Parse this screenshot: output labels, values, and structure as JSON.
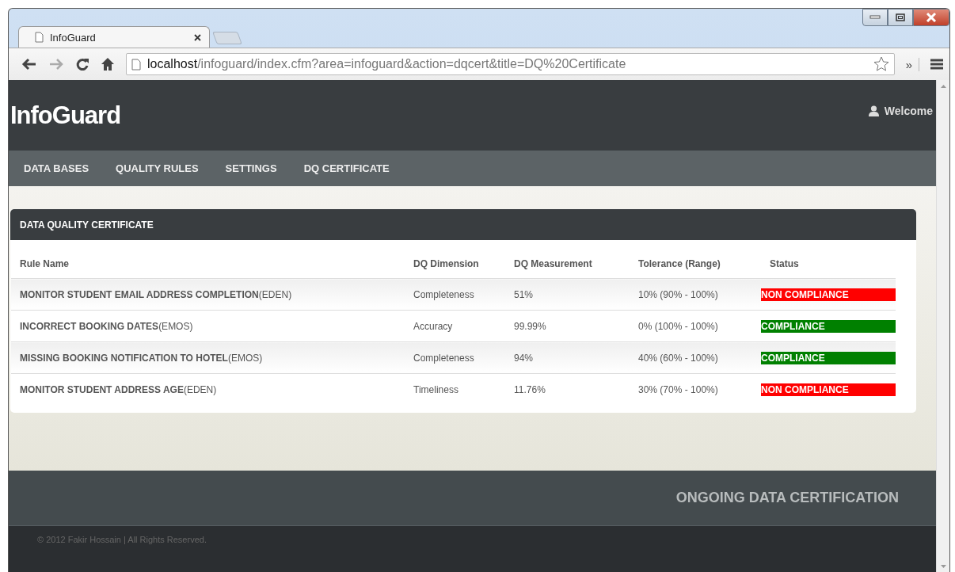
{
  "browser": {
    "tab": {
      "title": "InfoGuard",
      "selected": true
    },
    "address": {
      "host": "localhost",
      "path": "/infoguard/index.cfm?area=infoguard&action=dqcert&title=DQ%20Certificate"
    },
    "overflow": "»"
  },
  "header": {
    "brand": "InfoGuard",
    "user": "Welcome"
  },
  "nav": [
    {
      "label": "DATA BASES"
    },
    {
      "label": "QUALITY RULES"
    },
    {
      "label": "SETTINGS"
    },
    {
      "label": "DQ CERTIFICATE"
    }
  ],
  "panel": {
    "title": "DATA QUALITY CERTIFICATE",
    "table": {
      "columns": [
        "Rule Name",
        "DQ Dimension",
        "DQ Measurement",
        "Tolerance (Range)",
        "Status"
      ],
      "rows": [
        {
          "rule": "**MONITOR STUDENT EMAIL ADDRESS COMPLETION**(EDEN)",
          "dimension": "Completeness",
          "measurement": "51%",
          "tolerance": "10% (90% - 100%)",
          "status": {
            "label": "NON COMPLIANCE",
            "color": "#ff0000"
          }
        },
        {
          "rule": "**INCORRECT BOOKING DATES**(EMOS)",
          "dimension": "Accuracy",
          "measurement": "99.99%",
          "tolerance": "0% (100% - 100%)",
          "status": {
            "label": "COMPLIANCE",
            "color": "#008000"
          }
        },
        {
          "rule": "**MISSING BOOKING NOTIFICATION TO HOTEL**(EMOS)",
          "dimension": "Completeness",
          "measurement": "94%",
          "tolerance": "40% (60% - 100%)",
          "status": {
            "label": "COMPLIANCE",
            "color": "#008000"
          }
        },
        {
          "rule": "**MONITOR STUDENT ADDRESS AGE**(EDEN)",
          "dimension": "Timeliness",
          "measurement": "11.76%",
          "tolerance": "30% (70% - 100%)",
          "status": {
            "label": "NON COMPLIANCE",
            "color": "#ff0000"
          }
        }
      ]
    }
  },
  "footer": {
    "tagline": "ONGOING DATA CERTIFICATION",
    "copyright": "© 2012 Fakir Hossain | All Rights Reserved."
  }
}
